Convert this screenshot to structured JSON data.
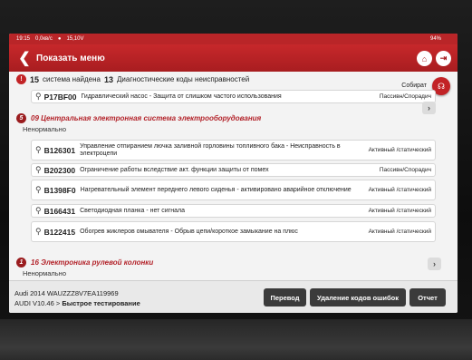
{
  "statusbar": {
    "time": "19:15",
    "data_rate": "0,0кв/с",
    "voltage": "15,10V",
    "battery": "94%"
  },
  "header": {
    "title": "Показать меню"
  },
  "summary": {
    "systems_count": "15",
    "systems_text": "система найдена",
    "dtc_count": "13",
    "dtc_text": "Диагностические коды неисправностей",
    "badge": "!"
  },
  "collect_label": "Собират",
  "top_row": {
    "code": "P17BF00",
    "description": "Гидравлический насос - Защита от слишком частого использования",
    "status": "Пассивн/Спорадич"
  },
  "section_09": {
    "number": "5",
    "title": "09 Центральная электронная система электрооборудования",
    "state": "Ненормально"
  },
  "fault_rows": [
    {
      "code": "B126301",
      "description": "Управление отпиранием лючка заливной горловины топливного бака - Неисправность в электроцепи",
      "status": "Активный /статический"
    },
    {
      "code": "B202300",
      "description": "Ограничение работы вследствие акт. функции защиты от помех",
      "status": "Пассивн/Спорадич"
    },
    {
      "code": "B1398F0",
      "description": "Нагревательный элемент переднего левого сиденья - активировано аварийное отключение",
      "status": "Активный /статический"
    },
    {
      "code": "B166431",
      "description": "Светодиодная планка - нет сигнала",
      "status": "Активный /статический"
    },
    {
      "code": "B122415",
      "description": "Обогрев жиклеров омывателя - Обрыв цепи/короткое замыкание на плюс",
      "status": "Активный /статический"
    }
  ],
  "section_16": {
    "number": "1",
    "title": "16 Электроника рулевой колонки",
    "state": "Ненормально"
  },
  "footer": {
    "vehicle": "Audi  2014  WAUZZZ8V7EA119969",
    "path_prefix": "AUDI V10.46 > ",
    "path_current": "Быстрое тестирование",
    "translate_label": "Перевод",
    "clear_codes_label": "Удаление кодов ошибок",
    "report_label": "Отчет"
  },
  "colors": {
    "accent": "#c22326",
    "section_title": "#b3232a"
  },
  "icons": [
    "back-arrow-icon",
    "home-icon",
    "exit-icon",
    "magnifier-icon",
    "chevron-right-icon",
    "headset-icon"
  ]
}
